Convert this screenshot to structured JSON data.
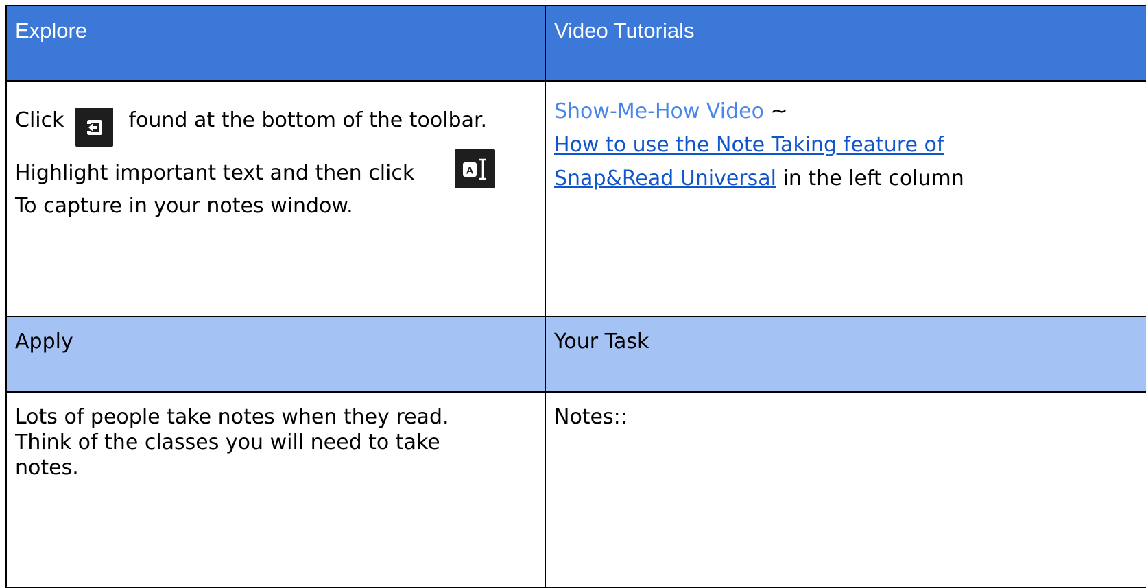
{
  "explore": {
    "header": "Explore",
    "step1_prefix": "Click",
    "step1_icon": "exit-arrow-icon",
    "step1_suffix": "found at the bottom of the toolbar.",
    "step2_prefix": "Highlight important text and then click",
    "step2_icon": "text-capture-icon",
    "step2_icon_letter": "A",
    "step2_suffix": "To capture in your notes window."
  },
  "video": {
    "header": "Video Tutorials",
    "label": "Show-Me-How Video",
    "separator": "~",
    "link_line1": "How to use the Note Taking feature of",
    "link_line2": "Snap&Read Universal",
    "trailing": "in the left column"
  },
  "apply": {
    "header": "Apply",
    "text_line1": "Lots of people take notes when they read.",
    "text_line2": "Think of the classes you will need to take",
    "text_line3": "notes."
  },
  "task": {
    "header": "Your Task",
    "notes_label": "Notes::"
  },
  "colors": {
    "header_dark": "#3c78d8",
    "header_light": "#a4c2f4",
    "label_blue": "#4a86e8",
    "link_blue": "#1155cc",
    "icon_tile": "#1e1e1e",
    "border": "#000000"
  }
}
